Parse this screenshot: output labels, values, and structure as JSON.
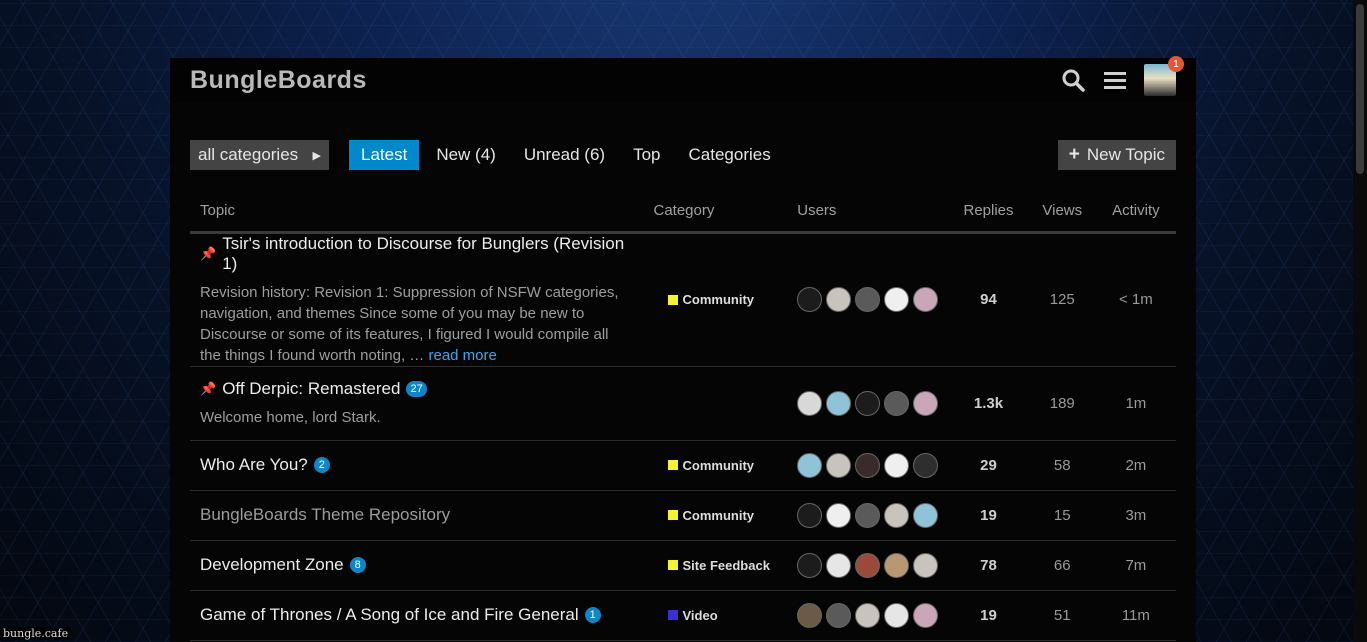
{
  "site": {
    "logo": "BungleBoards",
    "footer_host": "bungle.cafe",
    "notification_count": "1"
  },
  "nav": {
    "category_dropdown": "all categories",
    "filters": [
      "Latest",
      "New (4)",
      "Unread (6)",
      "Top",
      "Categories"
    ],
    "active_filter": "Latest",
    "new_topic": "New Topic"
  },
  "columns": {
    "topic": "Topic",
    "category": "Category",
    "users": "Users",
    "replies": "Replies",
    "views": "Views",
    "activity": "Activity"
  },
  "colors": {
    "accent": "#0088cc",
    "community": "#f5f52f",
    "site_feedback": "#f5f52f",
    "video": "#3a2fd0"
  },
  "topics": [
    {
      "title": "Tsir's introduction to Discourse for Bunglers (Revision 1)",
      "pinned": true,
      "badge": "",
      "excerpt": "Revision history: Revision 1: Suppression of NSFW categories, navigation, and themes Since some of you may be new to Discourse or some of its features, I figured I would compile all the things I found worth noting, … ",
      "read_more": "read more",
      "category": "Community",
      "category_color": "#f5f52f",
      "replies": "94",
      "views": "125",
      "activity": "< 1m",
      "avatars": [
        "#1c1c1c",
        "#c9c3bd",
        "#5a5a5a",
        "#efefef",
        "#c9a7b8"
      ]
    },
    {
      "title": "Off Derpic: Remastered",
      "pinned": true,
      "badge": "27",
      "excerpt": "Welcome home, lord Stark.",
      "read_more": "",
      "category": "",
      "category_color": "",
      "replies": "1.3k",
      "views": "189",
      "activity": "1m",
      "avatars": [
        "#d8d8d8",
        "#8fc4d8",
        "#1c1c1c",
        "#5a5a5a",
        "#c9a7b8"
      ]
    },
    {
      "title": "Who Are You?",
      "pinned": false,
      "badge": "2",
      "excerpt": "",
      "read_more": "",
      "category": "Community",
      "category_color": "#f5f52f",
      "replies": "29",
      "views": "58",
      "activity": "2m",
      "avatars": [
        "#8fc4d8",
        "#c9c3bd",
        "#3a2a2a",
        "#efefef",
        "#2e2e2e"
      ]
    },
    {
      "title": "BungleBoards Theme Repository",
      "pinned": false,
      "badge": "",
      "excerpt": "",
      "read_more": "",
      "category": "Community",
      "category_color": "#f5f52f",
      "replies": "19",
      "views": "15",
      "activity": "3m",
      "avatars": [
        "#1c1c1c",
        "#efefef",
        "#5a5a5a",
        "#c9c3bd",
        "#8fc4d8"
      ]
    },
    {
      "title": "Development Zone",
      "pinned": false,
      "badge": "8",
      "excerpt": "",
      "read_more": "",
      "category": "Site Feedback",
      "category_color": "#f5f52f",
      "replies": "78",
      "views": "66",
      "activity": "7m",
      "avatars": [
        "#1c1c1c",
        "#e6e6e6",
        "#9a4a3a",
        "#b89870",
        "#c9c3bd"
      ]
    },
    {
      "title": "Game of Thrones / A Song of Ice and Fire General",
      "pinned": false,
      "badge": "1",
      "excerpt": "",
      "read_more": "",
      "category": "Video",
      "category_color": "#3a2fd0",
      "replies": "19",
      "views": "51",
      "activity": "11m",
      "avatars": [
        "#6b5a45",
        "#5a5a5a",
        "#c9c3bd",
        "#e6e6e6",
        "#c9a7b8"
      ]
    }
  ]
}
